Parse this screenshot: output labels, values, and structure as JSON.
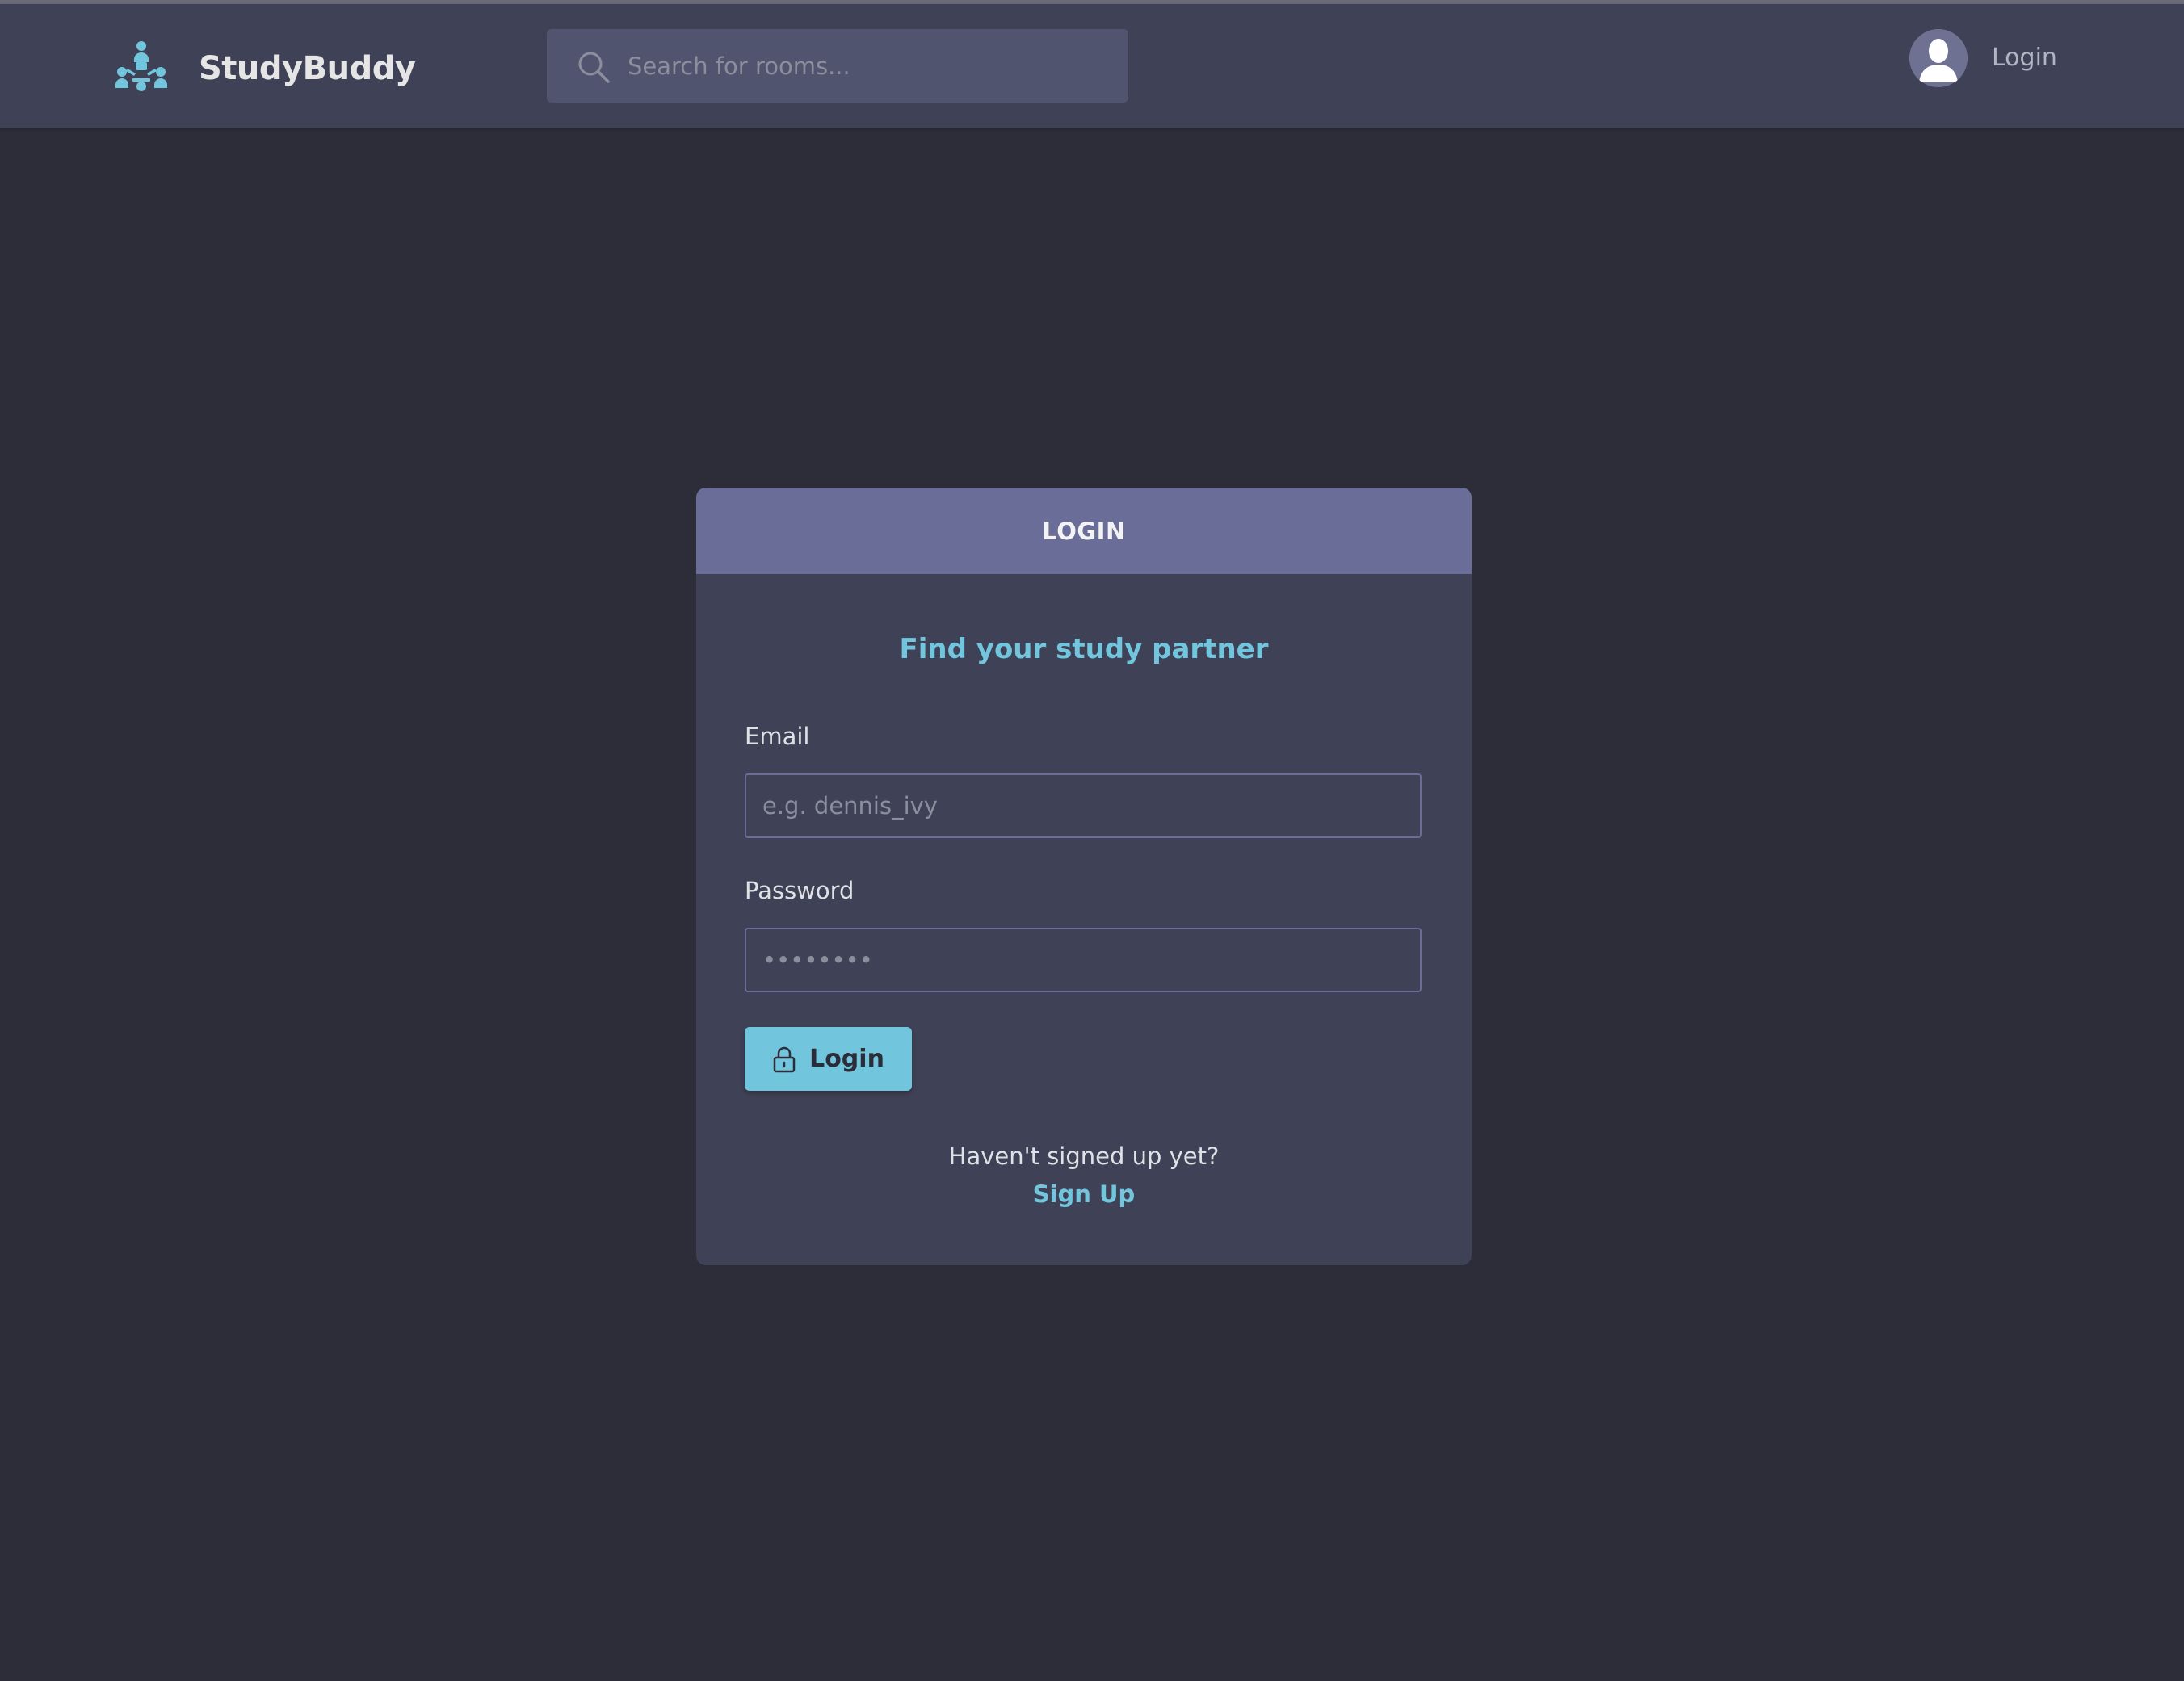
{
  "header": {
    "brand_name": "StudyBuddy",
    "logo_icon": "people-network-icon",
    "search": {
      "placeholder": "Search for rooms...",
      "value": "",
      "icon": "search-icon"
    },
    "avatar_icon": "user-avatar-icon",
    "login_label": "Login"
  },
  "login_card": {
    "title": "LOGIN",
    "subtitle": "Find your study partner",
    "email": {
      "label": "Email",
      "placeholder": "e.g. dennis_ivy",
      "value": ""
    },
    "password": {
      "label": "Password",
      "placeholder": "••••••••",
      "value": ""
    },
    "submit": {
      "label": "Login",
      "icon": "lock-icon"
    },
    "signup_prompt": "Haven't signed up yet?",
    "signup_link": "Sign Up"
  },
  "colors": {
    "background": "#2d2d39",
    "header": "#3f4156",
    "card_header": "#696d97",
    "accent": "#71c6dd",
    "input_border": "#696d97"
  }
}
